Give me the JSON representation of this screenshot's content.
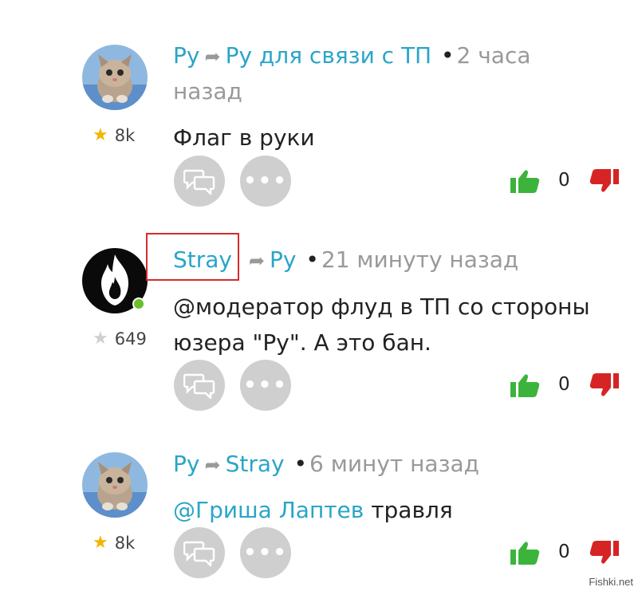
{
  "colors": {
    "link": "#2aa5c8",
    "like": "#3cb43c",
    "dislike": "#d62424",
    "button": "#cfcfcf",
    "highlight": "#d62b2b"
  },
  "comments": [
    {
      "author": "Ру",
      "reply_to": "Ру для связи с ТП",
      "time_line1": "2 часа",
      "time_line2": "назад",
      "rating": "8k",
      "star": "gold-star-icon",
      "text": "Флаг в руки",
      "votes": "0"
    },
    {
      "author": "Stray",
      "reply_to": "Ру",
      "time_line1": "21 минуту назад",
      "rating": "649",
      "star": "gray-star-icon",
      "text_line1": "@модератор флуд в ТП со стороны",
      "text_line2": "юзера \"Ру\". А это бан.",
      "votes": "0",
      "online": true
    },
    {
      "author": "Ру",
      "reply_to": "Stray",
      "time_line1": "6 минут назад",
      "rating": "8k",
      "star": "gold-star-icon",
      "mention": "@Гриша Лаптев",
      "text_rest": " травля",
      "votes": "0"
    }
  ],
  "watermark": "Fishki.net"
}
